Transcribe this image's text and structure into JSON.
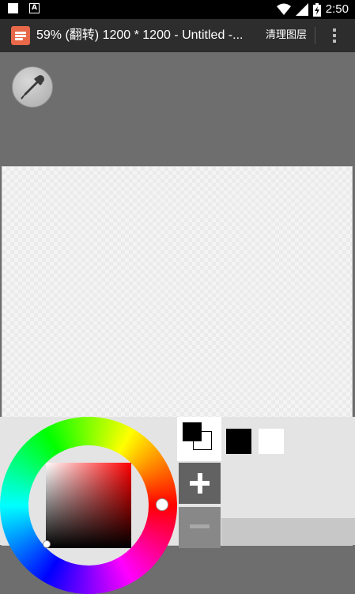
{
  "status_bar": {
    "time": "2:50",
    "notification_icons": [
      "square-notification-icon",
      "a-notification-icon"
    ],
    "system_icons": [
      "wifi-icon",
      "signal-icon",
      "battery-charging-icon"
    ]
  },
  "action_bar": {
    "app_icon": "layers-app-icon",
    "title": "59% (翻转) 1200 * 1200 - Untitled -...",
    "clear_layers_label": "清理图层",
    "overflow_icon": "more-vert-icon"
  },
  "tools": {
    "eyedropper_icon": "eyedropper-icon"
  },
  "color_panel": {
    "selected_hue_color": "#ff0000",
    "foreground_color": "#000000",
    "background_color": "#ffffff",
    "add_icon": "plus-icon",
    "remove_icon": "minus-icon",
    "palette": [
      {
        "color": "#000000"
      },
      {
        "color": "#ffffff"
      }
    ]
  }
}
